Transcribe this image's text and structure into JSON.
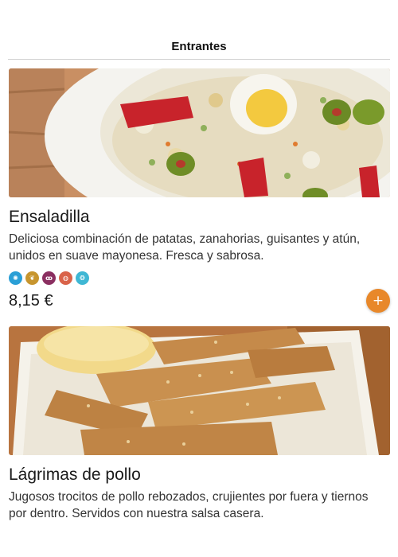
{
  "section": {
    "title": "Entrantes"
  },
  "products": [
    {
      "name": "Ensaladilla",
      "description": "Deliciosa combinación de patatas, zanahorias, guisantes y atún, unidos en suave mayonesa. Fresca y sabrosa.",
      "price": "8,15 €",
      "add_label": "+",
      "allergens": [
        {
          "icon": "crustaceans-icon",
          "color": "#2a9fd6",
          "glyph": "✺"
        },
        {
          "icon": "gluten-icon",
          "color": "#c7952e",
          "glyph": "❦"
        },
        {
          "icon": "eggs-icon",
          "color": "#8b2f61",
          "glyph": "ꝏ"
        },
        {
          "icon": "fish-icon",
          "color": "#d9634a",
          "glyph": "◍"
        },
        {
          "icon": "molluscs-icon",
          "color": "#3fb7d4",
          "glyph": "❂"
        }
      ]
    },
    {
      "name": "Lágrimas de pollo",
      "description": "Jugosos trocitos de pollo rebozados, crujientes por fuera y tiernos por dentro. Servidos con nuestra salsa casera."
    }
  ],
  "colors": {
    "accent": "#e8882a",
    "divider": "#cfcfcf"
  }
}
